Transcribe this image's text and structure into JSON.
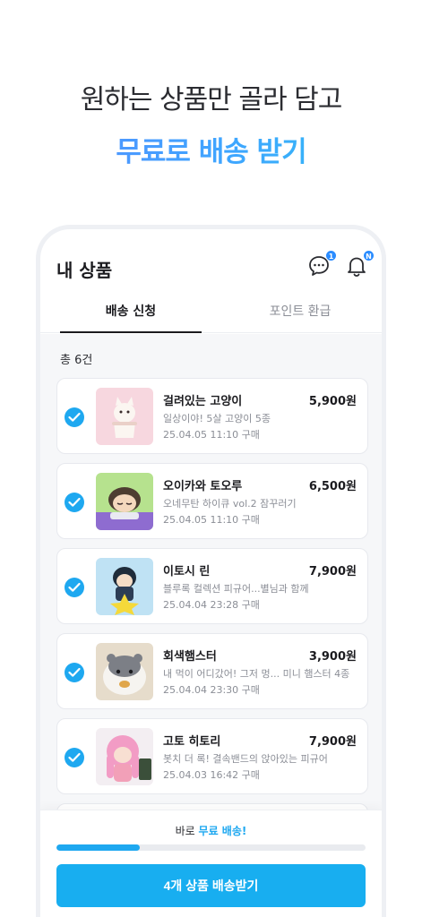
{
  "headline": {
    "line1": "원하는 상품만 골라 담고",
    "line2": "무료로 배송 받기"
  },
  "app": {
    "title": "내 상품",
    "chat_badge": "1",
    "bell_badge": "N",
    "tabs": [
      {
        "label": "배송 신청",
        "active": true
      },
      {
        "label": "포인트 환급",
        "active": false
      }
    ],
    "total_label": "총 6건"
  },
  "items": [
    {
      "name": "걸려있는 고양이",
      "price": "5,900원",
      "desc": "일상이야! 5살 고양이 5종",
      "date": "25.04.05 11:10 구매",
      "checked": true,
      "thumb_icon": "cat-figure"
    },
    {
      "name": "오이카와 토오루",
      "price": "6,500원",
      "desc": "오네무탄 하이큐 vol.2 잠꾸러기",
      "date": "25.04.05 11:10 구매",
      "checked": true,
      "thumb_icon": "sleeping-figure"
    },
    {
      "name": "이토시 린",
      "price": "7,900원",
      "desc": "블루록 컬렉션 피규어...별님과 함께",
      "date": "25.04.04 23:28 구매",
      "checked": true,
      "thumb_icon": "star-figure"
    },
    {
      "name": "회색햄스터",
      "price": "3,900원",
      "desc": "내 먹이 어디갔어! 그저 멍... 미니 햄스터 4종",
      "date": "25.04.04 23:30 구매",
      "checked": true,
      "thumb_icon": "hamster-figure"
    },
    {
      "name": "고토 히토리",
      "price": "7,900원",
      "desc": "봇치 더 록! 결속밴드의 앉아있는 피규어",
      "date": "25.04.03 16:42 구매",
      "checked": true,
      "thumb_icon": "pink-hair-figure"
    }
  ],
  "bottom": {
    "promo_prefix": "바로 ",
    "promo_highlight": "무료 배송!",
    "progress": 0.27,
    "cta_label": "4개 상품 배송받기"
  },
  "colors": {
    "accent": "#1ea8f0",
    "gradient_start": "#5a8cff",
    "gradient_end": "#2fc2f0"
  }
}
